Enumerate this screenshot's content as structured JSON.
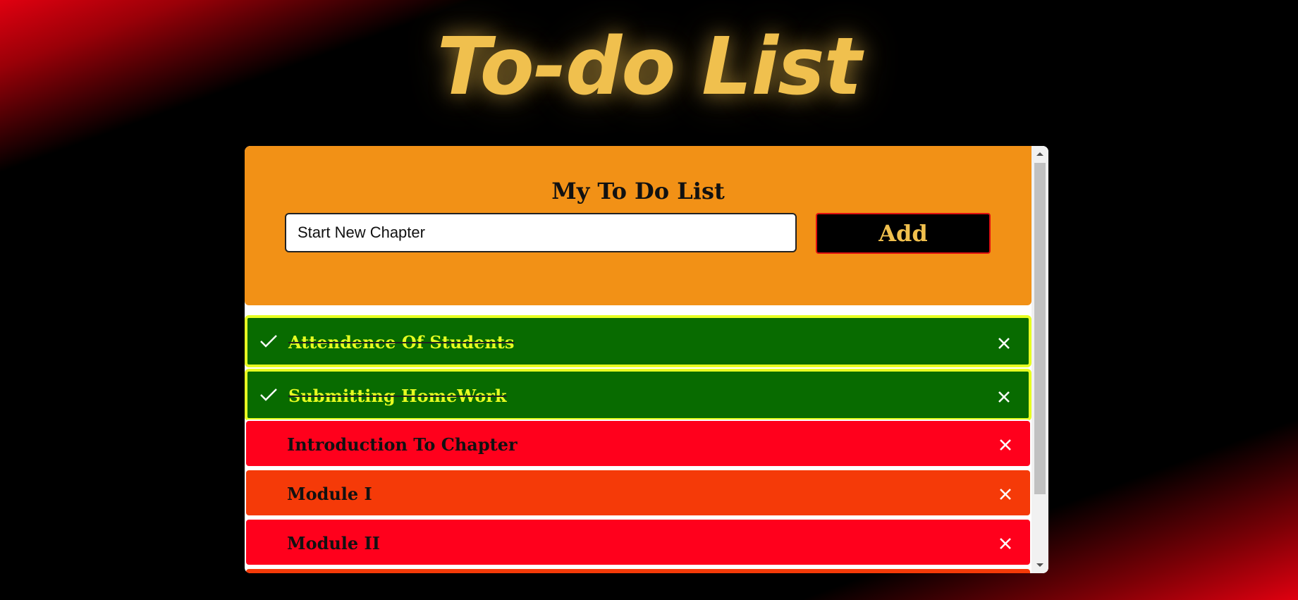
{
  "app": {
    "title": "To-do List"
  },
  "card": {
    "heading": "My To Do List",
    "input_value": "Start New Chapter",
    "add_label": "Add"
  },
  "tasks": [
    {
      "label": "Attendence Of Students",
      "status": "done",
      "color": "#086b00"
    },
    {
      "label": "Submitting HomeWork",
      "status": "done",
      "color": "#086b00"
    },
    {
      "label": "Introduction To Chapter",
      "status": "todo",
      "color": "#ff001c"
    },
    {
      "label": "Module I",
      "status": "todo",
      "color": "#f53a08"
    },
    {
      "label": "Module II",
      "status": "todo",
      "color": "#ff001c"
    },
    {
      "label": "",
      "status": "todo",
      "color": "#f53a08"
    }
  ],
  "colors": {
    "title": "#f0c04e",
    "header_bg": "#f29116",
    "done_bg": "#086b00",
    "done_border": "#e7ff21",
    "todo_red": "#ff001c",
    "todo_orange": "#f53a08"
  },
  "icons": {
    "check": "check-icon",
    "close": "close-icon"
  }
}
